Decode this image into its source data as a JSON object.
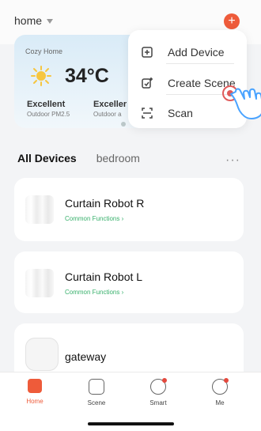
{
  "header": {
    "home_label": "home",
    "add_button_symbol": "+"
  },
  "weather": {
    "home_name": "Cozy Home",
    "temperature": "34°C",
    "stats": [
      {
        "value": "Excellent",
        "label": "Outdoor PM2.5"
      },
      {
        "value": "Exceller",
        "label": "Outdoor a"
      }
    ]
  },
  "menu": {
    "items": [
      {
        "label": "Add Device",
        "icon": "add-device-icon"
      },
      {
        "label": "Create Scene",
        "icon": "create-scene-icon"
      },
      {
        "label": "Scan",
        "icon": "scan-icon"
      }
    ]
  },
  "tabs": {
    "all_devices": "All Devices",
    "bedroom": "bedroom",
    "more": "···"
  },
  "devices": [
    {
      "name": "Curtain Robot  R",
      "subtitle": "Common Functions ›"
    },
    {
      "name": "Curtain Robot  L",
      "subtitle": "Common Functions ›"
    },
    {
      "name": "gateway",
      "subtitle": ""
    }
  ],
  "bottom_nav": {
    "items": [
      {
        "label": "Home",
        "icon": "home-icon"
      },
      {
        "label": "Scene",
        "icon": "scene-icon"
      },
      {
        "label": "Smart",
        "icon": "smart-icon"
      },
      {
        "label": "Me",
        "icon": "profile-icon"
      }
    ]
  },
  "colors": {
    "accent": "#ee5b3a",
    "green": "#37b06b"
  }
}
